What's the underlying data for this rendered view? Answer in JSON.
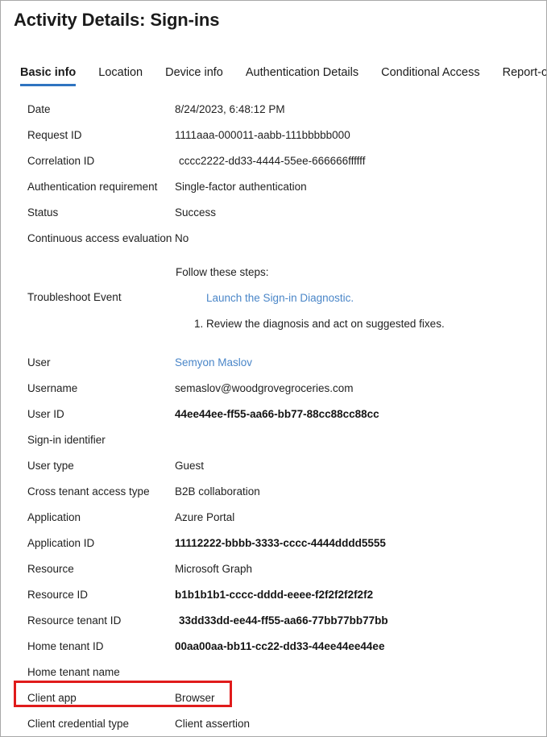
{
  "window": {
    "title": "Activity Details: Sign-ins",
    "border_color": "#a8a8a8"
  },
  "tabs": [
    {
      "label": "Basic info",
      "active": true
    },
    {
      "label": "Location",
      "active": false
    },
    {
      "label": "Device info",
      "active": false
    },
    {
      "label": "Authentication Details",
      "active": false
    },
    {
      "label": "Conditional Access",
      "active": false
    },
    {
      "label": "Report-only",
      "active": false
    }
  ],
  "colors": {
    "accent": "#2f74c0",
    "link": "#4a86c8",
    "highlight": "#e01b1b",
    "text": "#1f1f1f"
  },
  "rows_top": [
    {
      "label": "Date",
      "value": "8/24/2023, 6:48:12 PM",
      "style": "normal"
    },
    {
      "label": "Request ID",
      "value": "1111aaa-000011-aabb-111bbbbb000",
      "style": "normal"
    },
    {
      "label": "Correlation ID",
      "value": "cccc2222-dd33-4444-55ee-666666ffffff",
      "style": "indent"
    },
    {
      "label": "Authentication requirement",
      "value": "Single-factor authentication",
      "style": "normal"
    },
    {
      "label": "Status",
      "value": "Success",
      "style": "normal"
    },
    {
      "label": "Continuous access evaluation",
      "value": "No",
      "style": "normal"
    }
  ],
  "troubleshoot": {
    "label": "Troubleshoot Event",
    "intro": "Follow these steps:",
    "link": "Launch the Sign-in Diagnostic.",
    "step": "1. Review the diagnosis and act on suggested fixes."
  },
  "rows_bottom": [
    {
      "label": "User",
      "value": "Semyon Maslov",
      "style": "link"
    },
    {
      "label": "Username",
      "value": "semaslov@woodgrovegroceries.com",
      "style": "normal"
    },
    {
      "label": "User ID",
      "value": "44ee44ee-ff55-aa66-bb77-88cc88cc88cc",
      "style": "bold"
    },
    {
      "label": "Sign-in identifier",
      "value": "",
      "style": "normal"
    },
    {
      "label": "User type",
      "value": "Guest",
      "style": "normal"
    },
    {
      "label": "Cross tenant access type",
      "value": "B2B collaboration",
      "style": "normal"
    },
    {
      "label": "Application",
      "value": "Azure Portal",
      "style": "normal"
    },
    {
      "label": "Application ID",
      "value": "11112222-bbbb-3333-cccc-4444dddd5555",
      "style": "bold"
    },
    {
      "label": "Resource",
      "value": "Microsoft Graph",
      "style": "normal"
    },
    {
      "label": "Resource ID",
      "value": "b1b1b1b1-cccc-dddd-eeee-f2f2f2f2f2f2",
      "style": "bold"
    },
    {
      "label": "Resource tenant ID",
      "value": "33dd33dd-ee44-ff55-aa66-77bb77bb77bb",
      "style": "bold-indent"
    },
    {
      "label": "Home tenant ID",
      "value": "00aa00aa-bb11-cc22-dd33-44ee44ee44ee",
      "style": "bold"
    },
    {
      "label": "Home tenant name",
      "value": "",
      "style": "normal"
    },
    {
      "label": "Client app",
      "value": "Browser",
      "style": "normal"
    },
    {
      "label": "Client credential type",
      "value": "Client assertion",
      "style": "normal"
    }
  ]
}
